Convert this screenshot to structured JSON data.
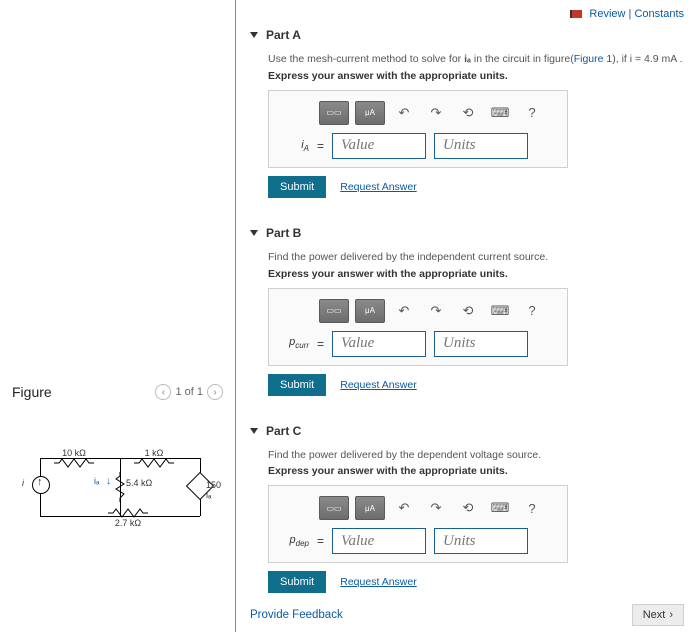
{
  "topLinks": {
    "review": "Review",
    "constants": "Constants",
    "sep": " | "
  },
  "figure": {
    "heading": "Figure",
    "pager_label": "1 of 1",
    "labels": {
      "source": "i",
      "dep": "150 iₐ",
      "r10": "10 kΩ",
      "r1": "1 kΩ",
      "r54": "5.4 kΩ",
      "r27": "2.7 kΩ",
      "ia": "iₐ"
    }
  },
  "parts": {
    "a": {
      "title": "Part A",
      "prompt_pre": "Use the mesh-current method to solve for ",
      "prompt_var": "iₐ",
      "prompt_mid": " in the circuit in figure(",
      "figlink": "Figure 1",
      "prompt_post": "), if i = 4.9 mA .",
      "var_html": "iₐ"
    },
    "b": {
      "title": "Part B",
      "prompt": "Find the power delivered by the independent current source.",
      "var_html": "pcurr"
    },
    "c": {
      "title": "Part C",
      "prompt": "Find the power delivered by the dependent voltage source.",
      "var_html": "pdep"
    }
  },
  "shared": {
    "instr": "Express your answer with the appropriate units.",
    "value_ph": "Value",
    "units_ph": "Units",
    "submit": "Submit",
    "request": "Request Answer",
    "eq": "="
  },
  "footer": {
    "provide": "Provide Feedback",
    "next": "Next"
  },
  "icons": {
    "undo": "↶",
    "redo": "↷",
    "reset": "⟲",
    "keyboard": "⌨",
    "help": "?",
    "prev": "‹",
    "next": "›",
    "nextArrow": "›"
  }
}
